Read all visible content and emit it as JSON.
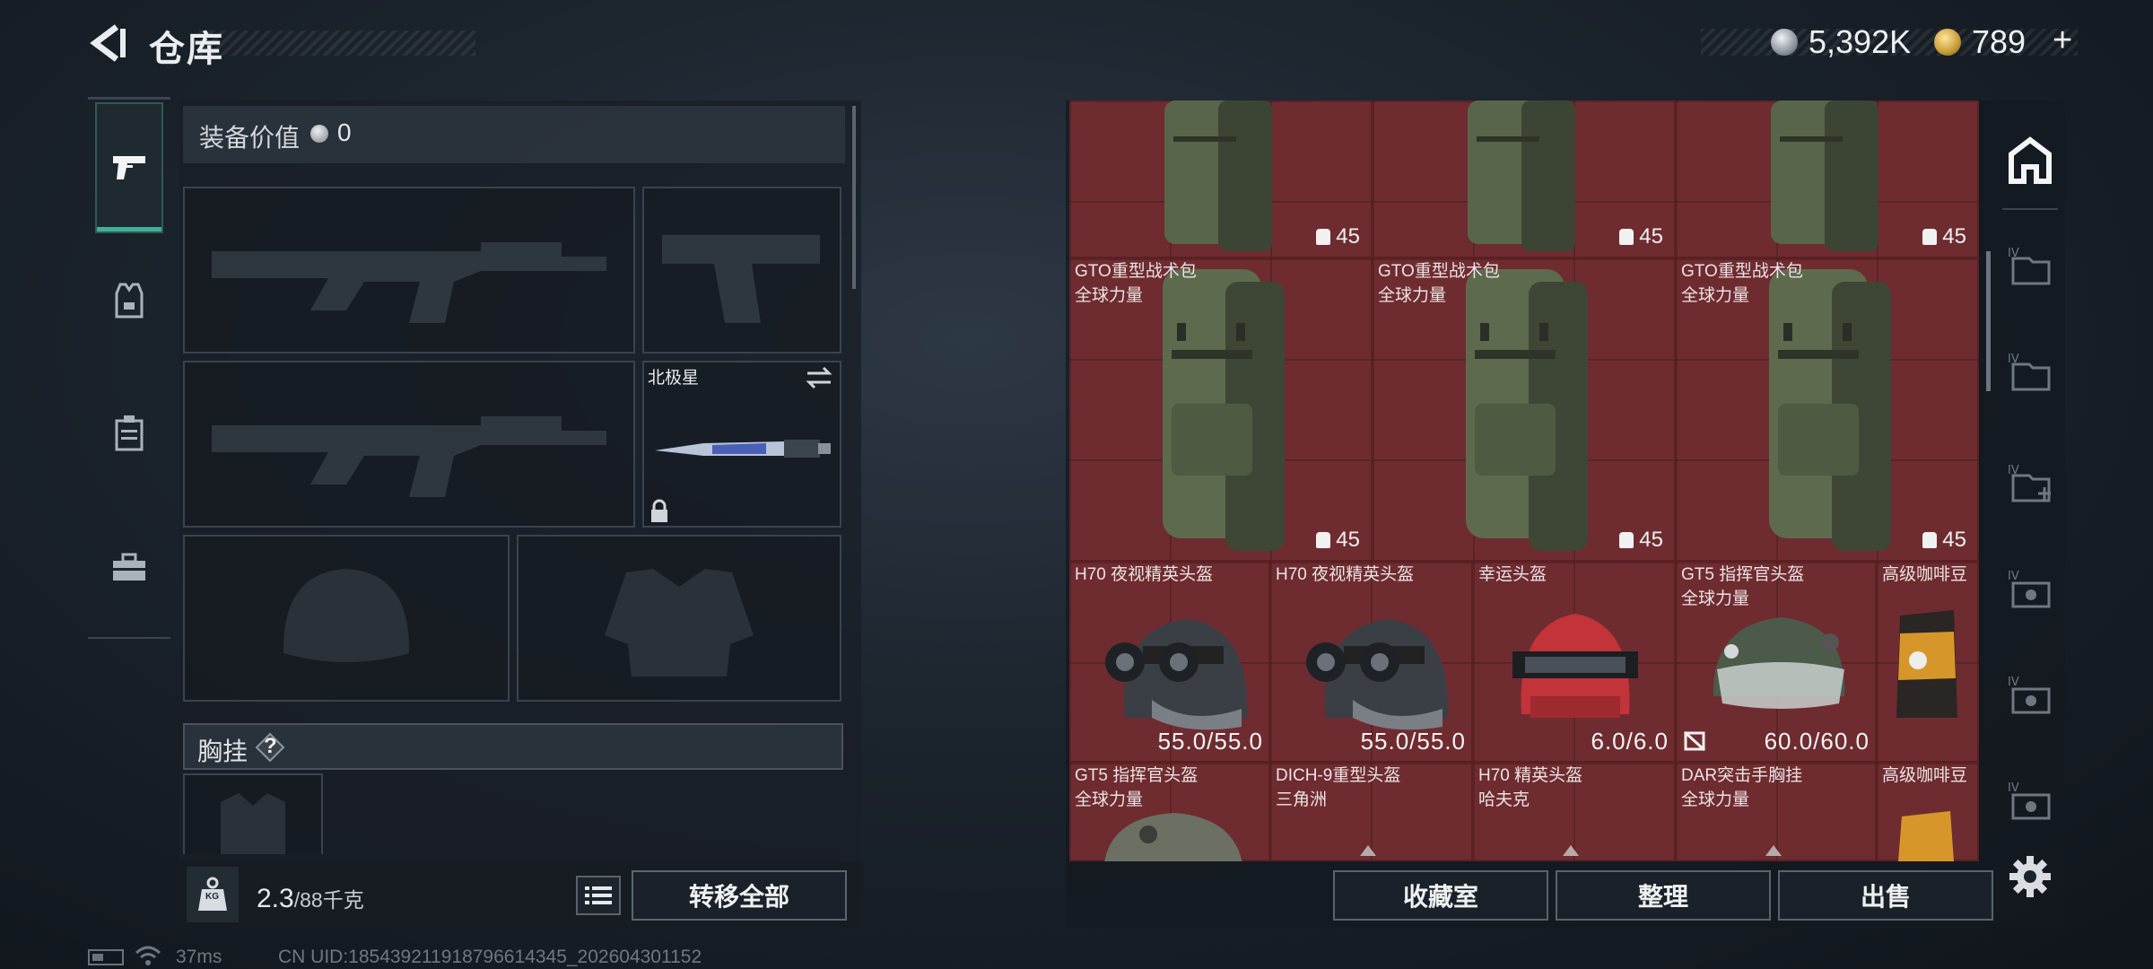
{
  "header": {
    "title": "仓库",
    "currency_silver": "5,392K",
    "currency_gold": "789",
    "plus": "+"
  },
  "left_tabs": [
    "weapon",
    "armor",
    "chest-rig",
    "case"
  ],
  "loadout": {
    "equipment_value_label": "装备价值",
    "equipment_value": "0",
    "melee_name": "北极星",
    "chest_rig_label": "胸挂",
    "chest_help": "?",
    "weight": "2.3",
    "weight_unit": "/88千克",
    "weight_icon": "KG",
    "transfer_all": "转移全部"
  },
  "inventory": {
    "backpack_name": "GTO重型战术包",
    "backpack_sub": "全球力量",
    "backpack_capacity": "45",
    "helmets": [
      {
        "name": "H70 夜视精英头盔",
        "sub": "",
        "durability": "55.0/55.0"
      },
      {
        "name": "H70 夜视精英头盔",
        "sub": "",
        "durability": "55.0/55.0"
      },
      {
        "name": "幸运头盔",
        "sub": "",
        "durability": "6.0/6.0"
      },
      {
        "name": "GT5 指挥官头盔",
        "sub": "全球力量",
        "durability": "60.0/60.0"
      },
      {
        "name": "高级咖啡豆",
        "sub": "",
        "durability": ""
      }
    ],
    "row4": [
      {
        "name": "GT5 指挥官头盔",
        "sub": "全球力量"
      },
      {
        "name": "DICH-9重型头盔",
        "sub": "三角洲"
      },
      {
        "name": "H70 精英头盔",
        "sub": "哈夫克"
      },
      {
        "name": "DAR突击手胸挂",
        "sub": "全球力量"
      },
      {
        "name": "高级咖啡豆",
        "sub": ""
      }
    ]
  },
  "actions": {
    "collection": "收藏室",
    "sort": "整理",
    "sell": "出售"
  },
  "status": {
    "ping": "37ms",
    "uid": "CN UID:185439211918796614345_202604301152"
  },
  "colors": {
    "grid_red": "#6f2c30",
    "accent_teal": "#3fb09a"
  }
}
